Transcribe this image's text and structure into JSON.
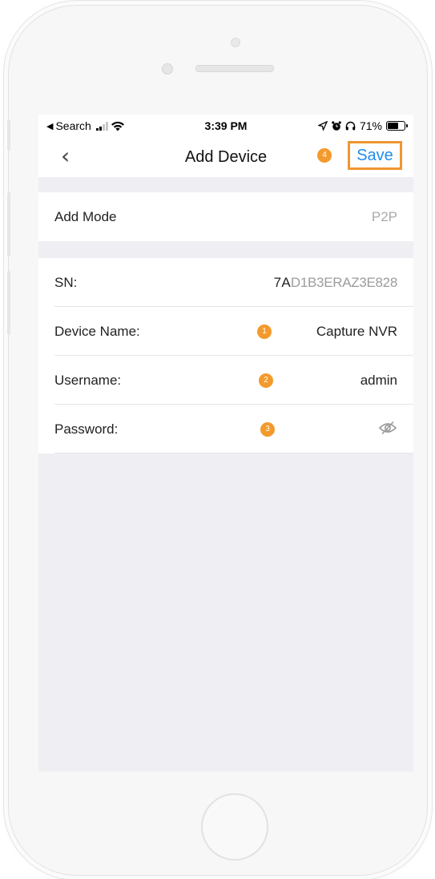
{
  "status_bar": {
    "back_app": "Search",
    "time": "3:39 PM",
    "battery": "71%",
    "battery_level": 0.71
  },
  "nav": {
    "back_icon": "chevron-left-icon",
    "title": "Add Device",
    "save_label": "Save",
    "save_badge": "4"
  },
  "mode_section": {
    "label": "Add Mode",
    "value": "P2P"
  },
  "device_section": {
    "sn_label": "SN:",
    "sn_value_visible": "7A",
    "sn_value_obscured": "D1B3ERAZ3E828",
    "name_label": "Device Name:",
    "name_value": "Capture NVR",
    "name_badge": "1",
    "username_label": "Username:",
    "username_value": "admin",
    "username_badge": "2",
    "password_label": "Password:",
    "password_badge": "3",
    "password_icon": "eye-slash-icon"
  },
  "colors": {
    "accent": "#1f8df0",
    "badge": "#f39a2c",
    "highlight_border": "#f0962f",
    "background": "#efeff3"
  }
}
